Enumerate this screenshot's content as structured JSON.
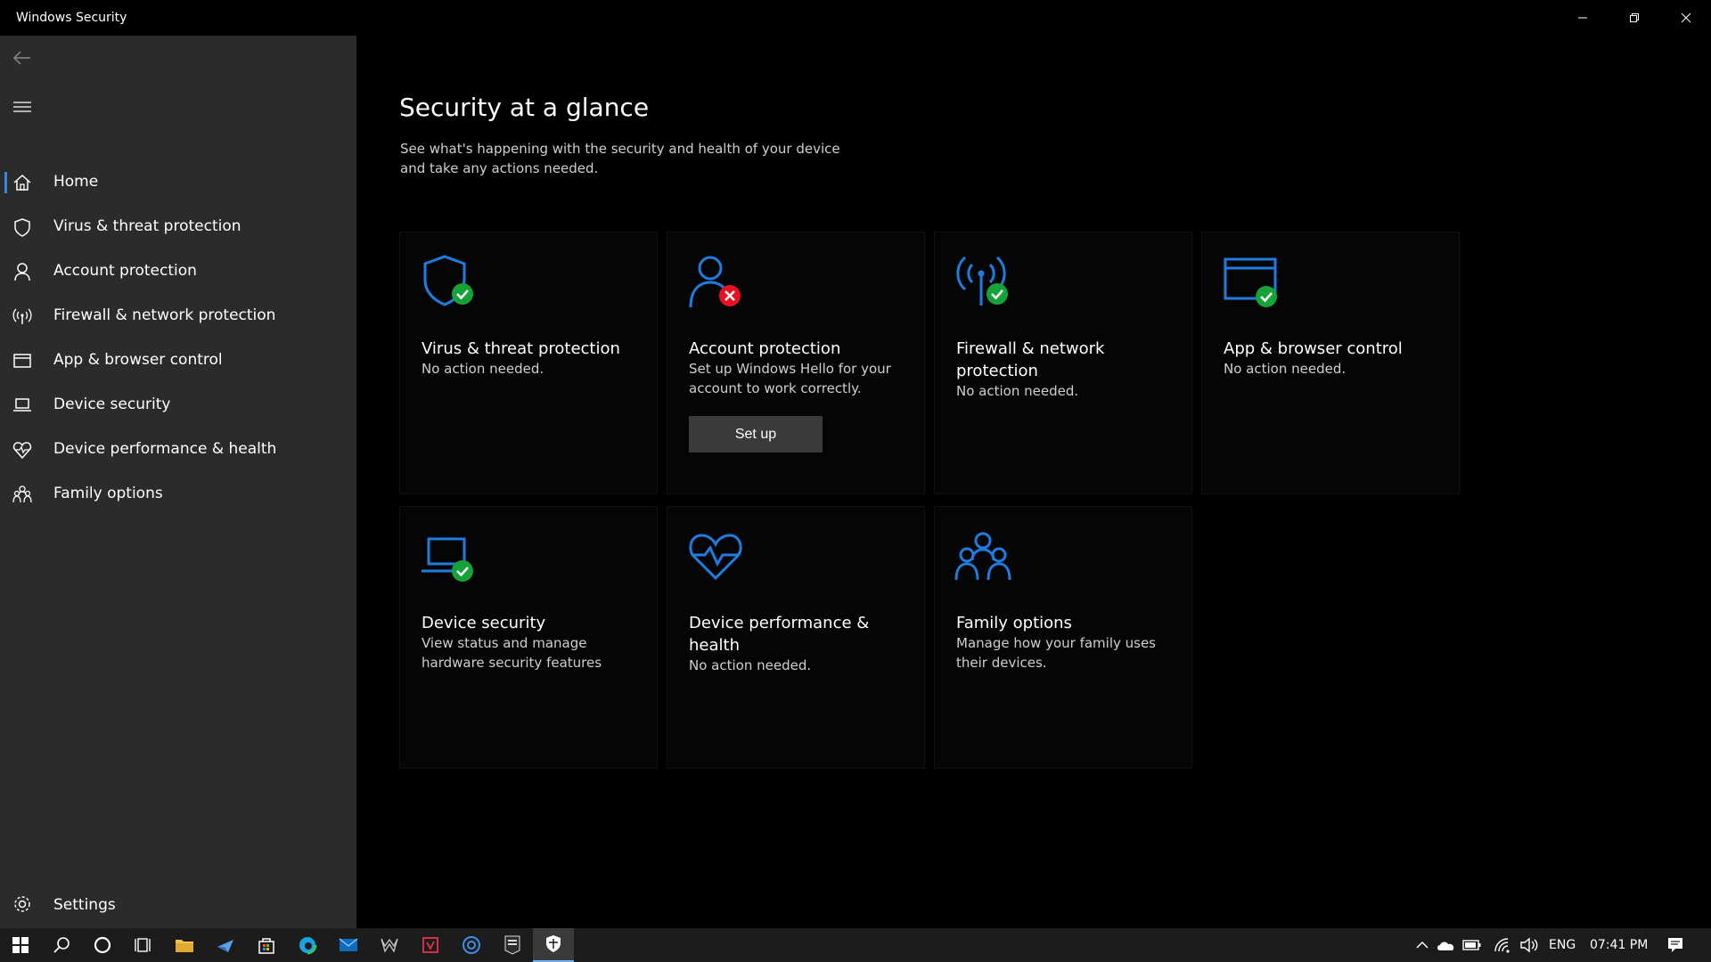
{
  "window": {
    "title": "Windows Security"
  },
  "colors": {
    "accent": "#1e7de0",
    "ok_green": "#15a339",
    "error_red": "#e81123",
    "sidebar_bg": "#2b2b2b"
  },
  "sidebar": {
    "items": [
      {
        "label": "Home",
        "icon": "home-icon",
        "active": true
      },
      {
        "label": "Virus & threat protection",
        "icon": "shield-icon"
      },
      {
        "label": "Account protection",
        "icon": "person-icon"
      },
      {
        "label": "Firewall & network protection",
        "icon": "antenna-icon"
      },
      {
        "label": "App & browser control",
        "icon": "browser-window-icon"
      },
      {
        "label": "Device security",
        "icon": "laptop-icon"
      },
      {
        "label": "Device performance & health",
        "icon": "heart-icon"
      },
      {
        "label": "Family options",
        "icon": "family-icon"
      }
    ],
    "settings_label": "Settings"
  },
  "main": {
    "title": "Security at a glance",
    "subtitle": "See what's happening with the security and health of your device and take any actions needed.",
    "cards": [
      {
        "title": "Virus & threat protection",
        "desc": "No action needed.",
        "status": "ok"
      },
      {
        "title": "Account protection",
        "desc": "Set up Windows Hello for your account to work correctly.",
        "status": "error",
        "button": "Set up"
      },
      {
        "title": "Firewall & network protection",
        "desc": "No action needed.",
        "status": "ok"
      },
      {
        "title": "App & browser control",
        "desc": "No action needed.",
        "status": "ok"
      },
      {
        "title": "Device security",
        "desc": "View status and manage hardware security features",
        "status": "ok"
      },
      {
        "title": "Device performance & health",
        "desc": "No action needed.",
        "status": "none"
      },
      {
        "title": "Family options",
        "desc": "Manage how your family uses their devices.",
        "status": "none"
      }
    ]
  },
  "taskbar": {
    "language": "ENG",
    "time": "07:41 PM"
  }
}
